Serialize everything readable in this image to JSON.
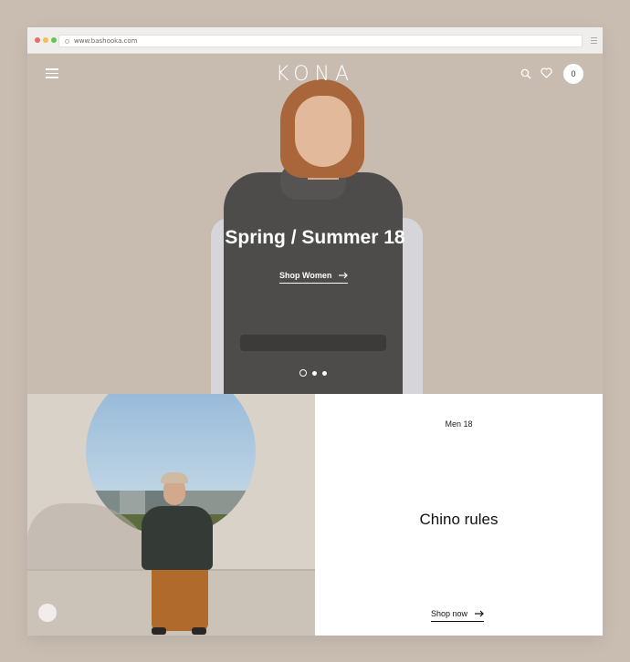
{
  "browser": {
    "url": "www.bashooka.com",
    "traffic_lights": [
      "#ed6b60",
      "#f5be4f",
      "#62c554"
    ]
  },
  "header": {
    "logo": "KONA",
    "menu_icon": "hamburger-icon",
    "search_icon": "search-icon",
    "wishlist_icon": "heart-icon",
    "cart_count": "0"
  },
  "hero": {
    "title": "Spring / Summer 18",
    "cta_label": "Shop Women",
    "cta_icon": "arrow-right-icon",
    "slides": 3,
    "active_slide": 1
  },
  "promo": {
    "kicker": "Men 18",
    "title": "Chino rules",
    "cta_label": "Shop now",
    "cta_icon": "arrow-right-icon"
  },
  "colors": {
    "page_background": "#c9bdb2",
    "hero_background": "#c8bcb0",
    "text_dark": "#111111",
    "white": "#ffffff"
  }
}
